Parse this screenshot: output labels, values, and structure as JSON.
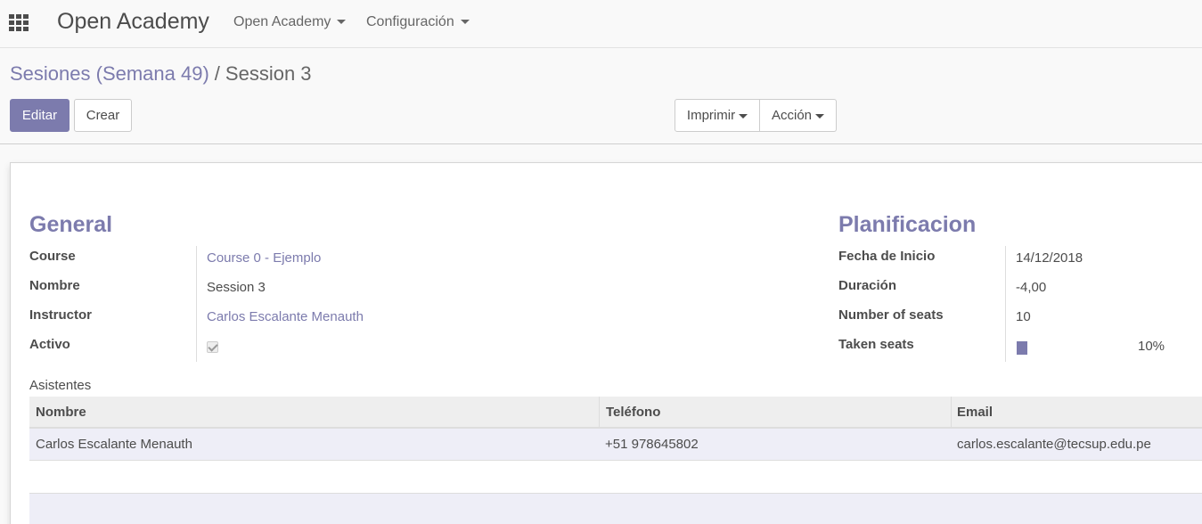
{
  "navbar": {
    "brand": "Open Academy",
    "menus": [
      {
        "label": "Open Academy"
      },
      {
        "label": "Configuración"
      }
    ]
  },
  "breadcrumb": {
    "parent": "Sesiones (Semana 49)",
    "separator": "/",
    "current": "Session 3"
  },
  "buttons": {
    "edit": "Editar",
    "create": "Crear",
    "print": "Imprimir",
    "action": "Acción"
  },
  "form": {
    "general": {
      "title": "General",
      "fields": {
        "course": {
          "label": "Course",
          "value": "Course 0 - Ejemplo"
        },
        "name": {
          "label": "Nombre",
          "value": "Session 3"
        },
        "instructor": {
          "label": "Instructor",
          "value": "Carlos Escalante Menauth"
        },
        "active": {
          "label": "Activo",
          "checked": true
        }
      }
    },
    "planning": {
      "title": "Planificacion",
      "fields": {
        "start_date": {
          "label": "Fecha de Inicio",
          "value": "14/12/2018"
        },
        "duration": {
          "label": "Duración",
          "value": "-4,00"
        },
        "seats": {
          "label": "Number of seats",
          "value": "10"
        },
        "taken_seats": {
          "label": "Taken seats",
          "value": "10%",
          "fraction": 0.1
        }
      }
    }
  },
  "attendees": {
    "label": "Asistentes",
    "columns": [
      "Nombre",
      "Teléfono",
      "Email"
    ],
    "rows": [
      {
        "name": "Carlos Escalante Menauth",
        "phone": "+51 978645802",
        "email": "carlos.escalante@tecsup.edu.pe"
      }
    ]
  },
  "colors": {
    "accent": "#7c7bad",
    "text": "#4c4c4c"
  }
}
